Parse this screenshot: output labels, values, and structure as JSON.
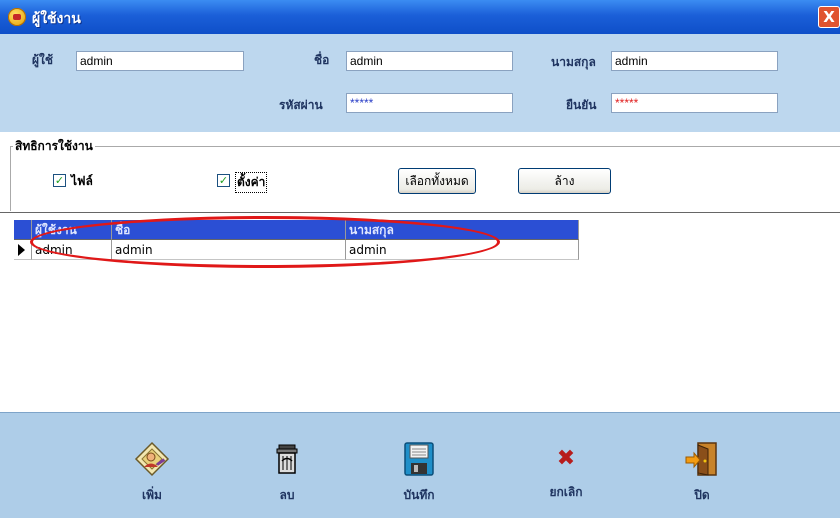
{
  "window": {
    "title": "ผู้ใช้งาน",
    "close_glyph": "X"
  },
  "form": {
    "user_label": "ผู้ใช้",
    "user_value": "admin",
    "name_label": "ชื่อ",
    "name_value": "admin",
    "surname_label": "นามสกุล",
    "surname_value": "admin",
    "password_label": "รหัสผ่าน",
    "password_value": "*****",
    "confirm_label": "ยืนยัน",
    "confirm_value": "*****"
  },
  "permissions": {
    "title": "สิทธิการใช้งาน",
    "file_label": "ไฟล์",
    "file_checked": true,
    "settings_label": "ตั้งค่า",
    "settings_checked": true,
    "select_all_label": "เลือกทั้งหมด",
    "clear_label": "ล้าง",
    "check_glyph": "✓"
  },
  "grid": {
    "headers": [
      "ผู้ใช้งาน",
      "ชื่อ",
      "นามสกุล"
    ],
    "rows": [
      [
        "admin",
        "admin",
        "admin"
      ]
    ]
  },
  "toolbar": {
    "add_label": "เพิ่ม",
    "delete_label": "ลบ",
    "save_label": "บันทึก",
    "cancel_label": "ยกเลิก",
    "close_label": "ปิด",
    "cancel_glyph": "✖"
  },
  "colors": {
    "titlebar": "#1b5fd8",
    "header_bg": "#bdd7ee",
    "toolbar_bg": "#aecde8",
    "grid_header": "#2b4fd4",
    "highlight_ellipse": "#e01818"
  },
  "icons": [
    "app-icon",
    "close-icon",
    "add-user-icon",
    "trash-icon",
    "floppy-disk-icon",
    "cancel-x-icon",
    "exit-door-icon",
    "row-indicator-icon"
  ]
}
